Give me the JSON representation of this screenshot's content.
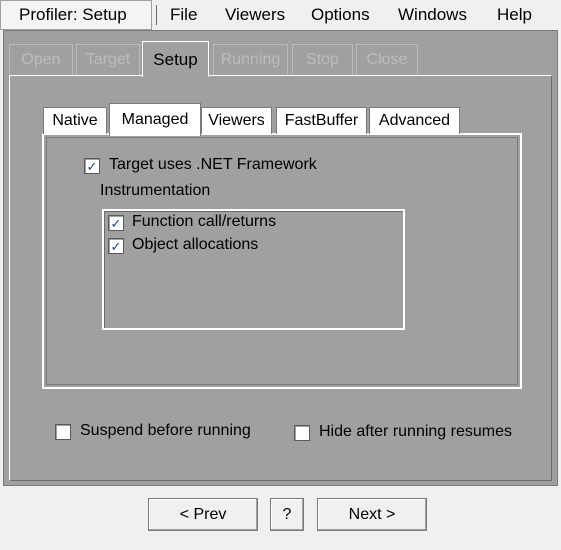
{
  "menubar": {
    "title": "Profiler: Setup",
    "items": [
      "File",
      "Viewers",
      "Options",
      "Windows",
      "Help"
    ]
  },
  "wizard_tabs": [
    "Open",
    "Target",
    "Setup",
    "Running",
    "Stop",
    "Close"
  ],
  "active_wizard_tab": "Setup",
  "inner_tabs": [
    "Native",
    "Managed",
    "Viewers",
    "FastBuffer",
    "Advanced"
  ],
  "active_inner_tab": "Managed",
  "managed": {
    "target_dotnet": {
      "label": "Target uses .NET Framework",
      "checked": true
    },
    "instrumentation_label": "Instrumentation",
    "options": [
      {
        "label": "Function call/returns",
        "checked": true
      },
      {
        "label": "Object allocations",
        "checked": true
      }
    ]
  },
  "suspend_before_running": {
    "label": "Suspend before running",
    "checked": false
  },
  "hide_after_running": {
    "label": "Hide after running resumes",
    "checked": false
  },
  "buttons": {
    "prev": "< Prev",
    "help": "?",
    "next": "Next >"
  },
  "check_glyph": "✓"
}
